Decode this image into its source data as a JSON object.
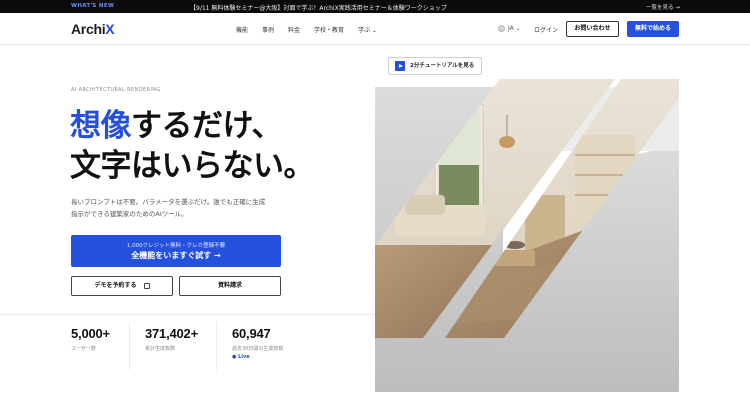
{
  "topbar": {
    "whats_new": "WHAT'S NEW",
    "announcement": "【9/11 無料体験セミナー@大阪】対面で学ぶ！ArchiX実践活用セミナー＆体験ワークショップ",
    "see_all": "一覧を見る →"
  },
  "header": {
    "logo_main": "Archi",
    "logo_x": "X",
    "nav": [
      "機能",
      "事例",
      "料金",
      "学校・教育",
      "学ぶ ⌄"
    ],
    "language": "JA ⌄",
    "login": "ログイン",
    "contact": "お問い合わせ",
    "start_free": "無料で始める"
  },
  "hero": {
    "eyebrow": "AI ARCHITECTURAL RENDERING",
    "headline_accent": "想像",
    "headline_rest": "するだけ、",
    "headline_line2": "文字はいらない。",
    "description": "長いプロンプトは不要。パラメータを選ぶだけ。誰でも正確に生成指示ができる建築家のためのAIツール。",
    "cta_small": "1,000クレジット無料・クレカ登録不要",
    "cta_big": "全機能をいますぐ試す →",
    "demo_button": "デモを予約する",
    "doc_button": "資料請求",
    "tutorial_button": "2分チュートリアルを見る"
  },
  "stats": [
    {
      "value": "5,000+",
      "label": "ユーザー数"
    },
    {
      "value": "371,402+",
      "label": "累計生成枚数"
    },
    {
      "value": "60,947",
      "label": "過去30日間の生成枚数",
      "live": "● Live"
    }
  ],
  "colors": {
    "accent": "#2450dd",
    "topbar": "#0b0b0b"
  }
}
